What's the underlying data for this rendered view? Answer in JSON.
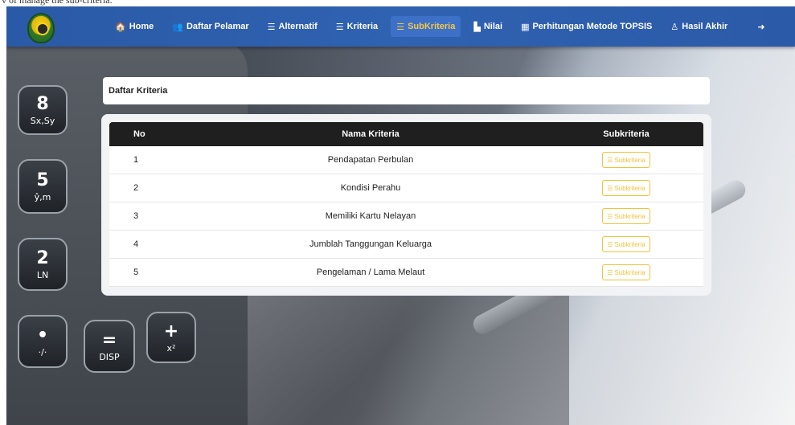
{
  "caption": "v of manage the sub-criteria.",
  "navbar": {
    "items": [
      {
        "icon": "home-icon",
        "glyph": "🏠",
        "label": "Home"
      },
      {
        "icon": "users-icon",
        "glyph": "👥",
        "label": "Daftar Pelamar"
      },
      {
        "icon": "list-icon",
        "glyph": "☰",
        "label": "Alternatif"
      },
      {
        "icon": "list-ol-icon",
        "glyph": "☰",
        "label": "Kriteria"
      },
      {
        "icon": "list-icon",
        "glyph": "☰",
        "label": "SubKriteria",
        "active": true
      },
      {
        "icon": "chart-icon",
        "glyph": "▙",
        "label": "Nilai"
      },
      {
        "icon": "calculator-icon",
        "glyph": "▦",
        "label": "Perhitungan Metode TOPSIS"
      },
      {
        "icon": "user-icon",
        "glyph": "♙",
        "label": "Hasil Akhir"
      },
      {
        "icon": "sign-out-icon",
        "glyph": "➜",
        "label": ""
      }
    ]
  },
  "calculator": {
    "keys": [
      {
        "main": "8",
        "sub": "Sx,Sy"
      },
      {
        "main": "5",
        "sub": "ŷ,m"
      },
      {
        "main": "2",
        "sub": "LN"
      },
      {
        "main": "•",
        "sub": "·/·"
      },
      {
        "main": "=",
        "sub": "DISP"
      },
      {
        "main": "+",
        "sub": "x²"
      }
    ]
  },
  "card_title": "Daftar Kriteria",
  "table": {
    "headers": {
      "no": "No",
      "name": "Nama Kriteria",
      "sub": "Subkriteria"
    },
    "button_label": "Subkriteria",
    "rows": [
      {
        "no": "1",
        "name": "Pendapatan Perbulan"
      },
      {
        "no": "2",
        "name": "Kondisi Perahu"
      },
      {
        "no": "3",
        "name": "Memiliki Kartu Nelayan"
      },
      {
        "no": "4",
        "name": "Jumblah Tanggungan Keluarga"
      },
      {
        "no": "5",
        "name": "Pengelaman / Lama Melaut"
      }
    ]
  },
  "colors": {
    "navbar": "#2f62b1",
    "active_text": "#f6c744",
    "button_accent": "#f2c23b",
    "table_header": "#1f1f1f"
  }
}
